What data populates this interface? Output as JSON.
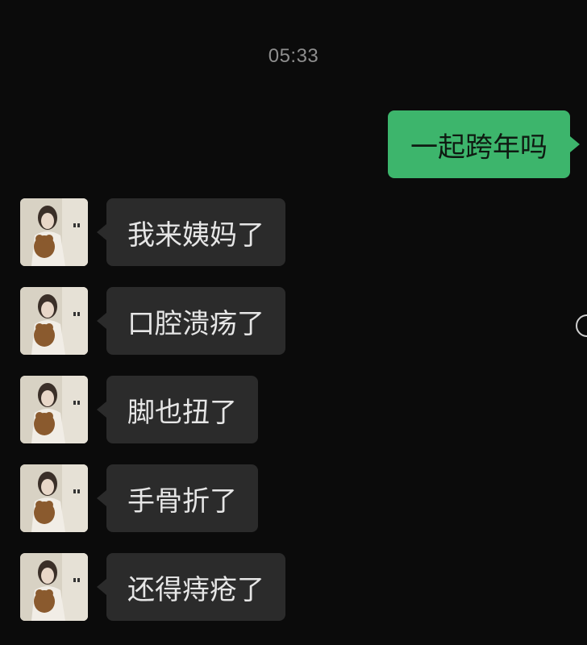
{
  "chat": {
    "timestamp": "05:33",
    "outgoing": [
      {
        "text": "一起跨年吗"
      }
    ],
    "incoming": [
      {
        "text": "我来姨妈了"
      },
      {
        "text": "口腔溃疡了"
      },
      {
        "text": "脚也扭了"
      },
      {
        "text": "手骨折了"
      },
      {
        "text": "还得痔疮了"
      }
    ]
  },
  "colors": {
    "background": "#0b0b0b",
    "outgoing_bubble": "#3db56c",
    "incoming_bubble": "#2b2b2b",
    "incoming_text": "#e6e6e6",
    "timestamp_text": "#8e8e8e"
  },
  "icons": {
    "avatar": "avatar-photo-icon",
    "edge_control": "circle-icon"
  }
}
